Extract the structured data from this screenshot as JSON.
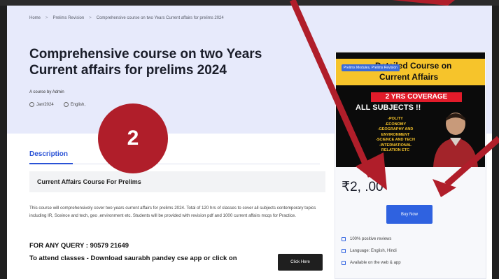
{
  "breadcrumb": {
    "home": "Home",
    "sep": ">",
    "category": "Prelims Revision",
    "current": "Comprehensive course on two Years Current affairs for prelims 2024"
  },
  "course": {
    "title": "Comprehensive course on two Years Current affairs for prelims 2024",
    "author": "A course by Admin",
    "date": "Jan/2024",
    "language": "English,"
  },
  "marker": {
    "number": "2"
  },
  "description": {
    "tab": "Description",
    "box_title": "Current Affairs Course For Prelims",
    "text": "This course will comprehensively cover two years current affairs for prelims 2024. Total of 120 hrs of classes to cover all subjects contemporary topics including IR, Sceince and tech, geo ,environment etc. Students will be provided with revision pdf and 1000 current affairs mcqs for Practice.",
    "query": "FOR ANY QUERY : 90579 21649",
    "attend": "To attend classes - Download saurabh pandey cse app or click on",
    "click_label": "Click Here"
  },
  "sidebar": {
    "thumb_title_1": "Detailed Course on",
    "thumb_title_2": "Current Affairs",
    "thumb_badge": "Prelims Modules, Prelims Revision",
    "thumb_coverage": "2 YRS COVERAGE",
    "thumb_all": "ALL SUBJECTS !!",
    "thumb_list": [
      "-POLITY",
      "-ECONOMY",
      "-GEOGRAPHY AND",
      "ENVIRONMENT",
      "-SCIENCE AND TECH",
      "-INTERNATIONAL",
      "RELATION ETC"
    ],
    "price": "₹2,    .00",
    "buy_label": "Buy Now",
    "features": [
      "100% positive reviews",
      "Language: English, Hindi",
      "Available on the web & app"
    ]
  },
  "colors": {
    "accent": "#2f62e0",
    "hero_bg": "#e7eafb",
    "marker_red": "#b01e2a",
    "thumb_yellow": "#f6c42b"
  }
}
